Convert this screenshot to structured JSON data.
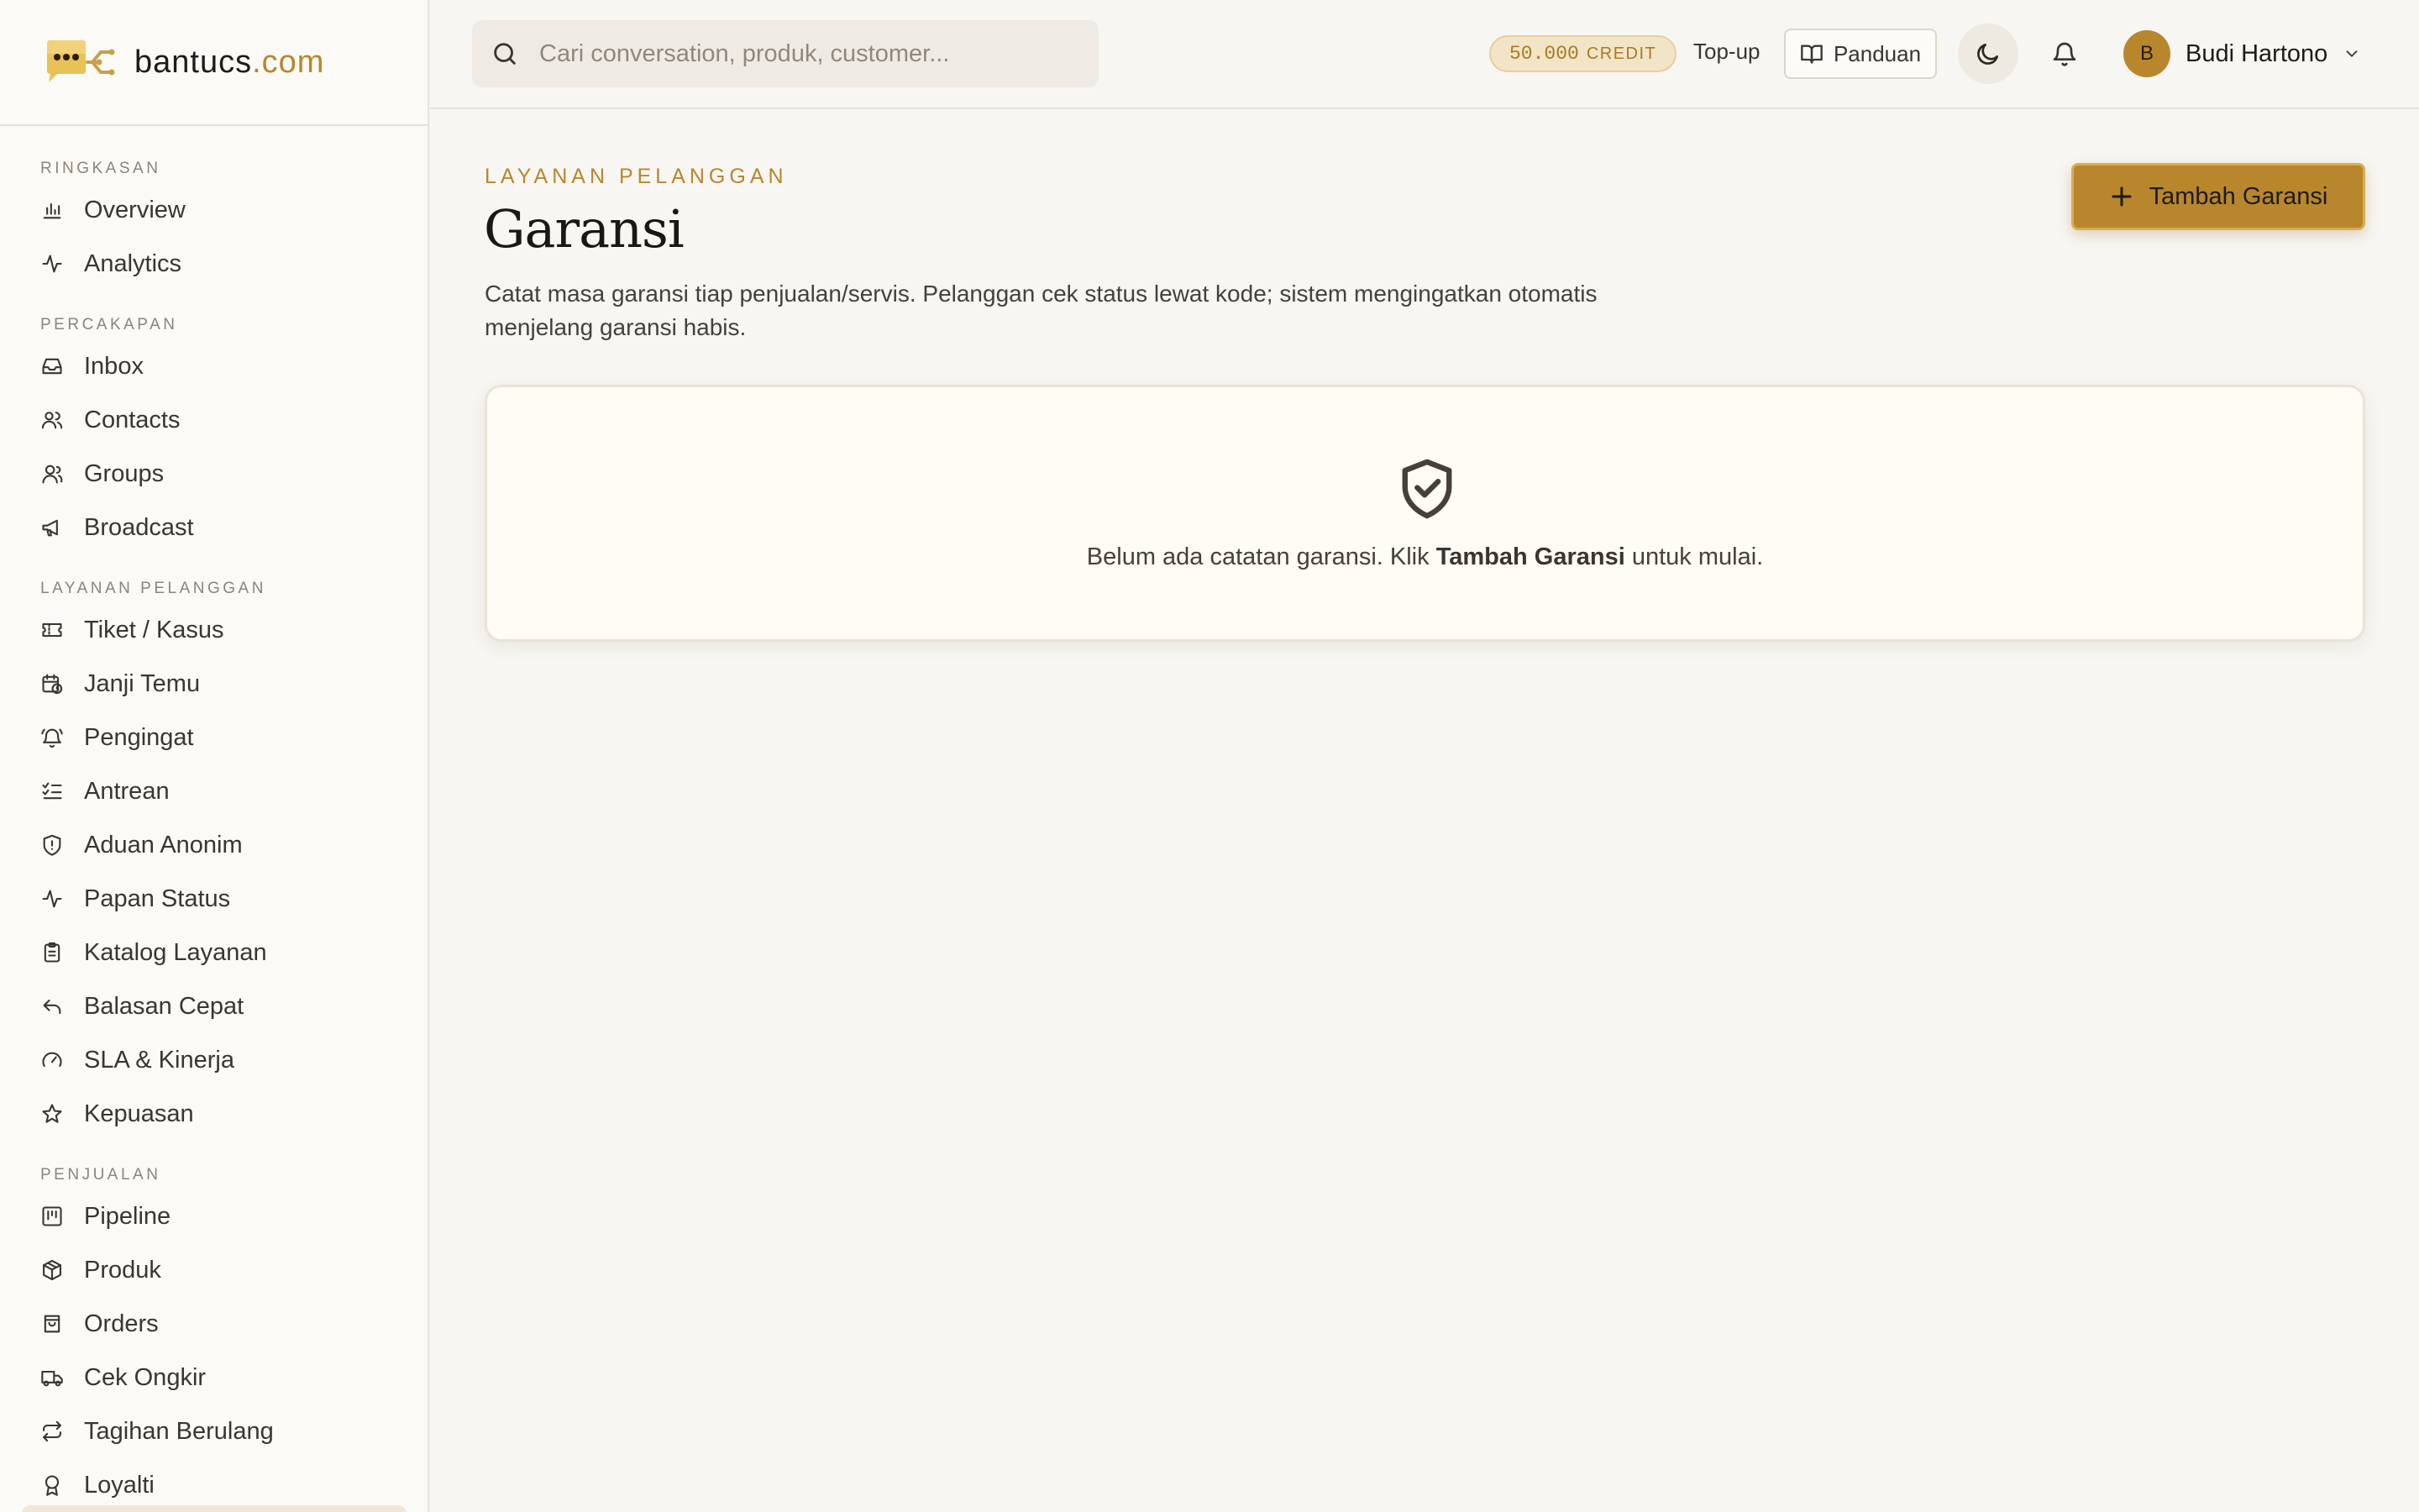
{
  "brand": {
    "name": "bantucs",
    "tld": ".com"
  },
  "sidebar": {
    "sections": [
      {
        "title": "RINGKASAN",
        "items": [
          {
            "label": "Overview",
            "icon": "bar-chart-icon"
          },
          {
            "label": "Analytics",
            "icon": "activity-icon"
          }
        ]
      },
      {
        "title": "PERCAKAPAN",
        "items": [
          {
            "label": "Inbox",
            "icon": "inbox-icon"
          },
          {
            "label": "Contacts",
            "icon": "users-icon"
          },
          {
            "label": "Groups",
            "icon": "user-group-icon"
          },
          {
            "label": "Broadcast",
            "icon": "megaphone-icon"
          }
        ]
      },
      {
        "title": "LAYANAN PELANGGAN",
        "items": [
          {
            "label": "Tiket / Kasus",
            "icon": "ticket-icon"
          },
          {
            "label": "Janji Temu",
            "icon": "calendar-clock-icon"
          },
          {
            "label": "Pengingat",
            "icon": "bell-ring-icon"
          },
          {
            "label": "Antrean",
            "icon": "list-checks-icon"
          },
          {
            "label": "Aduan Anonim",
            "icon": "shield-alert-icon"
          },
          {
            "label": "Papan Status",
            "icon": "activity-icon"
          },
          {
            "label": "Katalog Layanan",
            "icon": "clipboard-list-icon"
          },
          {
            "label": "Balasan Cepat",
            "icon": "reply-icon"
          },
          {
            "label": "SLA & Kinerja",
            "icon": "gauge-icon"
          },
          {
            "label": "Kepuasan",
            "icon": "star-icon"
          }
        ]
      },
      {
        "title": "PENJUALAN",
        "items": [
          {
            "label": "Pipeline",
            "icon": "kanban-icon"
          },
          {
            "label": "Produk",
            "icon": "package-icon"
          },
          {
            "label": "Orders",
            "icon": "shopping-bag-icon"
          },
          {
            "label": "Cek Ongkir",
            "icon": "truck-icon"
          },
          {
            "label": "Tagihan Berulang",
            "icon": "repeat-icon"
          },
          {
            "label": "Loyalti",
            "icon": "award-icon"
          }
        ]
      }
    ]
  },
  "topbar": {
    "search_placeholder": "Cari conversation, produk, customer...",
    "credit_amount": "50.000",
    "credit_label": "CREDIT",
    "topup_label": "Top-up",
    "guide_label": "Panduan",
    "user_initial": "B",
    "user_name": "Budi Hartono"
  },
  "page": {
    "eyebrow": "LAYANAN PELANGGAN",
    "title": "Garansi",
    "description": "Catat masa garansi tiap penjualan/servis. Pelanggan cek status lewat kode; sistem mengingatkan otomatis menjelang garansi habis.",
    "add_button": "Tambah Garansi",
    "empty_prefix": "Belum ada catatan garansi. Klik ",
    "empty_bold": "Tambah Garansi",
    "empty_suffix": " untuk mulai."
  },
  "colors": {
    "accent": "#b8862c",
    "background": "#f8f6f2",
    "sidebar": "#fcfaf6",
    "card": "#fffcf5"
  }
}
